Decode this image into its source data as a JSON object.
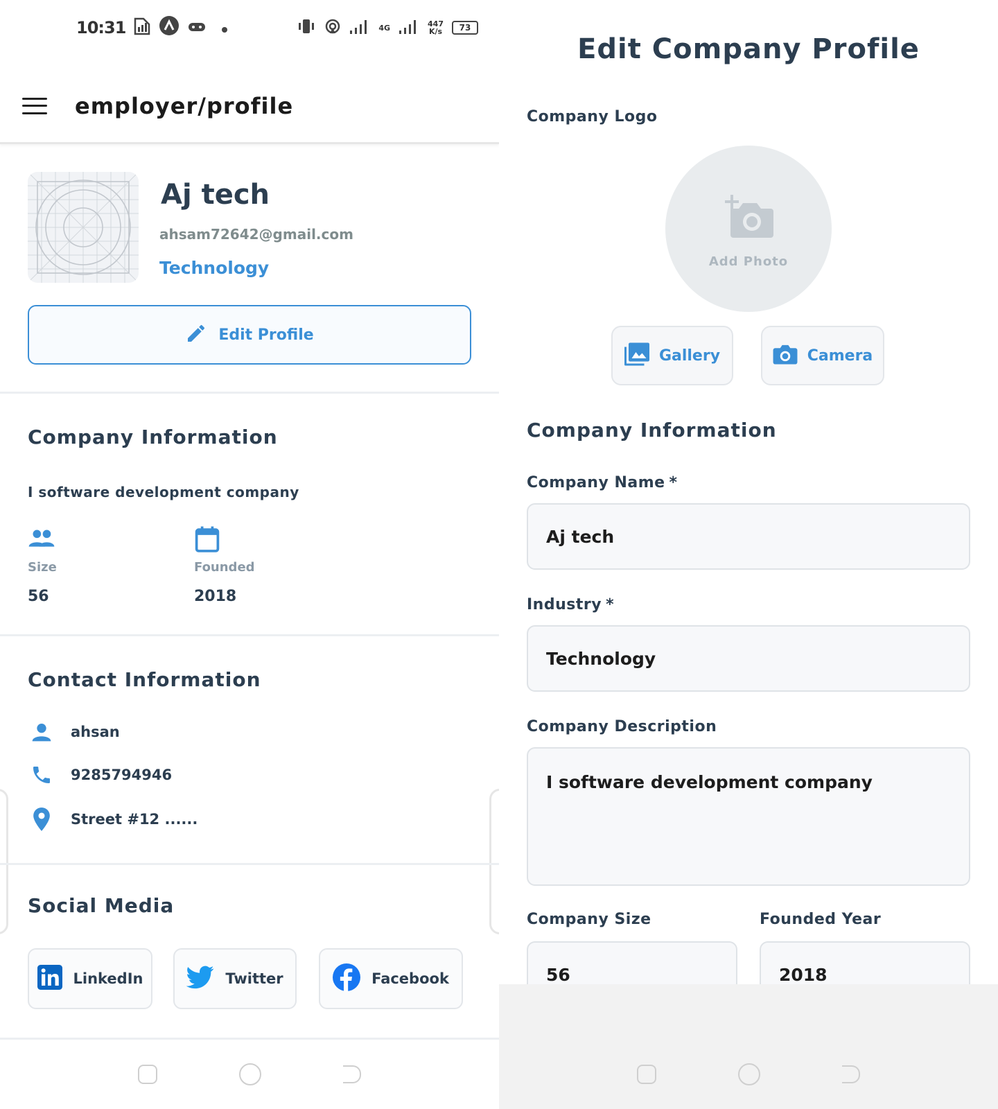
{
  "left": {
    "status": {
      "time": "10:31",
      "battery": "73",
      "network_type": "4G",
      "speed_value": "447",
      "speed_unit": "K/s"
    },
    "appbar": {
      "title": "employer/profile"
    },
    "profile": {
      "name": "Aj tech",
      "email": "ahsam72642@gmail.com",
      "industry": "Technology",
      "edit_label": "Edit Profile"
    },
    "company_info": {
      "title": "Company Information",
      "description": "I software development company",
      "size_label": "Size",
      "size_value": "56",
      "founded_label": "Founded",
      "founded_value": "2018"
    },
    "contact": {
      "title": "Contact Information",
      "name": "ahsan",
      "phone": "9285794946",
      "address": "Street #12 ......"
    },
    "social": {
      "title": "Social Media",
      "linkedin": "LinkedIn",
      "twitter": "Twitter",
      "facebook": "Facebook"
    }
  },
  "right": {
    "title": "Edit Company Profile",
    "logo_label": "Company Logo",
    "add_photo": "Add Photo",
    "gallery": "Gallery",
    "camera": "Camera",
    "section_title": "Company Information",
    "name_label": "Company Name",
    "name_value": "Aj tech",
    "industry_label": "Industry",
    "industry_value": "Technology",
    "desc_label": "Company Description",
    "desc_value": "I software development company",
    "size_label": "Company Size",
    "size_value": "56",
    "founded_label": "Founded Year",
    "founded_value": "2018",
    "required_mark": "*"
  },
  "colors": {
    "accent": "#3b8fd6",
    "text": "#2c3e50",
    "muted": "#8a99a6",
    "linkedin": "#0a66c2",
    "twitter": "#1d9bf0",
    "facebook": "#1877f2"
  }
}
